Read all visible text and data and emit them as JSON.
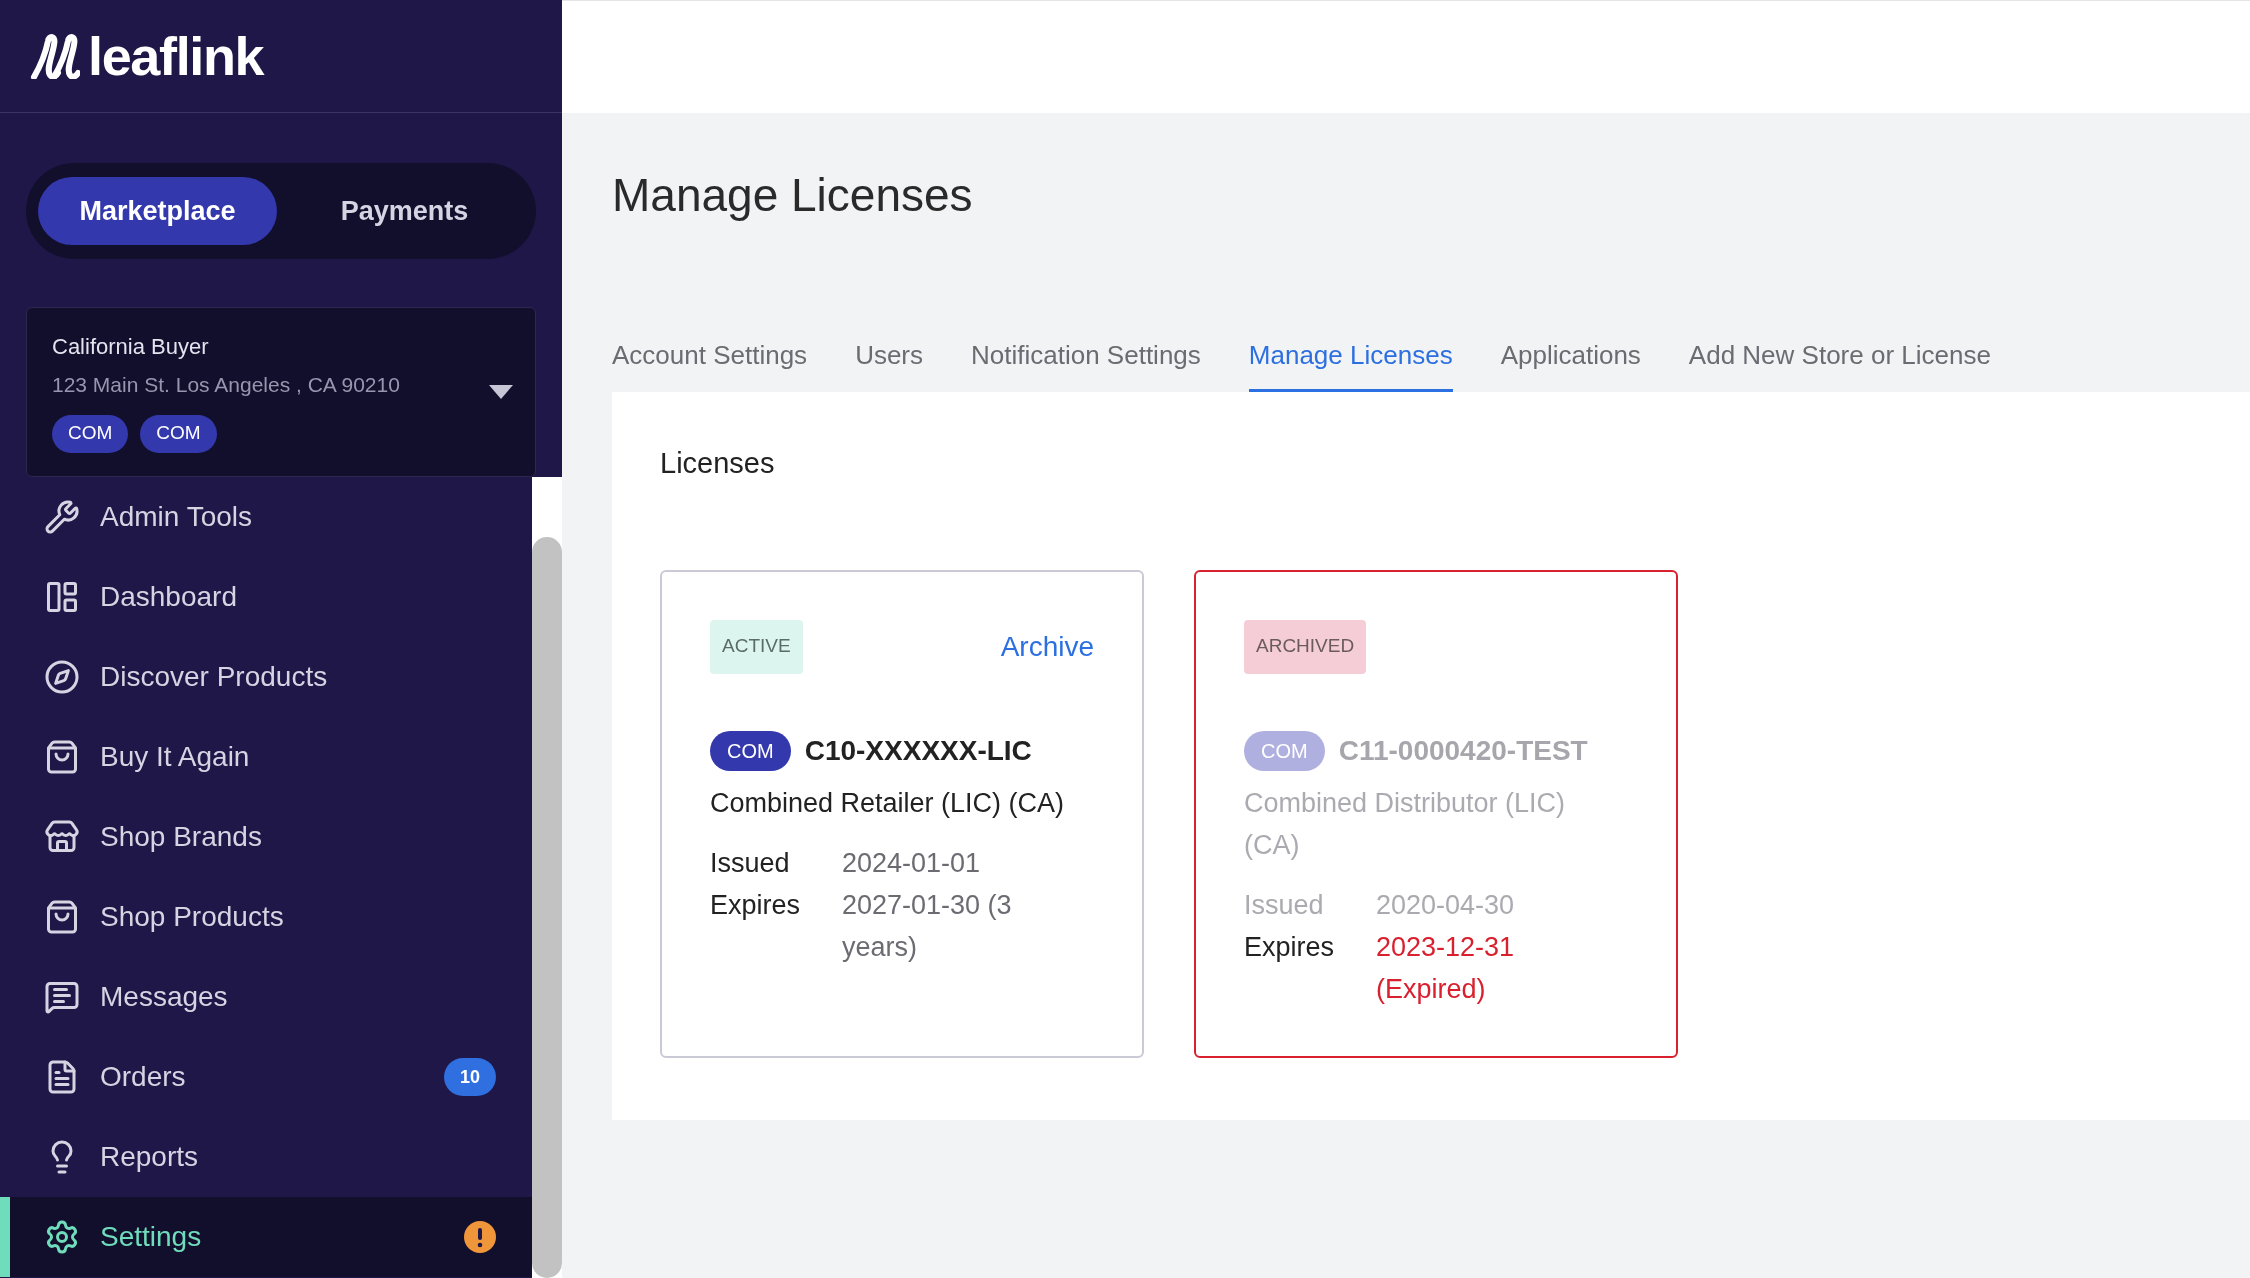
{
  "brand": {
    "name": "leaflink"
  },
  "mode_toggle": [
    {
      "label": "Marketplace",
      "selected": true
    },
    {
      "label": "Payments",
      "selected": false
    }
  ],
  "account": {
    "name": "California Buyer",
    "address": "123 Main St. Los Angeles , CA 90210",
    "badges": [
      "COM",
      "COM"
    ]
  },
  "nav": [
    {
      "label": "Admin Tools",
      "selected": false,
      "alert": false
    },
    {
      "label": "Dashboard",
      "selected": false,
      "alert": false
    },
    {
      "label": "Discover Products",
      "selected": false,
      "alert": false
    },
    {
      "label": "Buy It Again",
      "selected": false,
      "alert": false
    },
    {
      "label": "Shop Brands",
      "selected": false,
      "alert": false
    },
    {
      "label": "Shop Products",
      "selected": false,
      "alert": false
    },
    {
      "label": "Messages",
      "selected": false,
      "alert": false
    },
    {
      "label": "Orders",
      "selected": false,
      "alert": false,
      "badge": "10"
    },
    {
      "label": "Reports",
      "selected": false,
      "alert": false
    },
    {
      "label": "Settings",
      "selected": true,
      "alert": true
    }
  ],
  "page_title": "Manage Licenses",
  "tabs": [
    {
      "label": "Account Settings",
      "selected": false
    },
    {
      "label": "Users",
      "selected": false
    },
    {
      "label": "Notification Settings",
      "selected": false
    },
    {
      "label": "Manage Licenses",
      "selected": true
    },
    {
      "label": "Applications",
      "selected": false
    },
    {
      "label": "Add New Store or License",
      "selected": false
    }
  ],
  "panel": {
    "title": "Licenses",
    "licenses": [
      {
        "kind": "active",
        "status": "ACTIVE",
        "action": "Archive",
        "type": "COM",
        "number": "C10-XXXXXX-LIC",
        "name": "Combined Retailer (LIC) (CA)",
        "issued_label": "Issued",
        "issued": "2024-01-01",
        "expires_label": "Expires",
        "expires": "2027-01-30 (3 years)",
        "expired": false
      },
      {
        "kind": "archived",
        "status": "ARCHIVED",
        "type": "COM",
        "number": "C11-0000420-TEST",
        "name": "Combined Distributor (LIC) (CA)",
        "issued_label": "Issued",
        "issued": "2020-04-30",
        "expires_label": "Expires",
        "expires": "2023-12-31 (Expired)",
        "expired": true
      }
    ]
  }
}
